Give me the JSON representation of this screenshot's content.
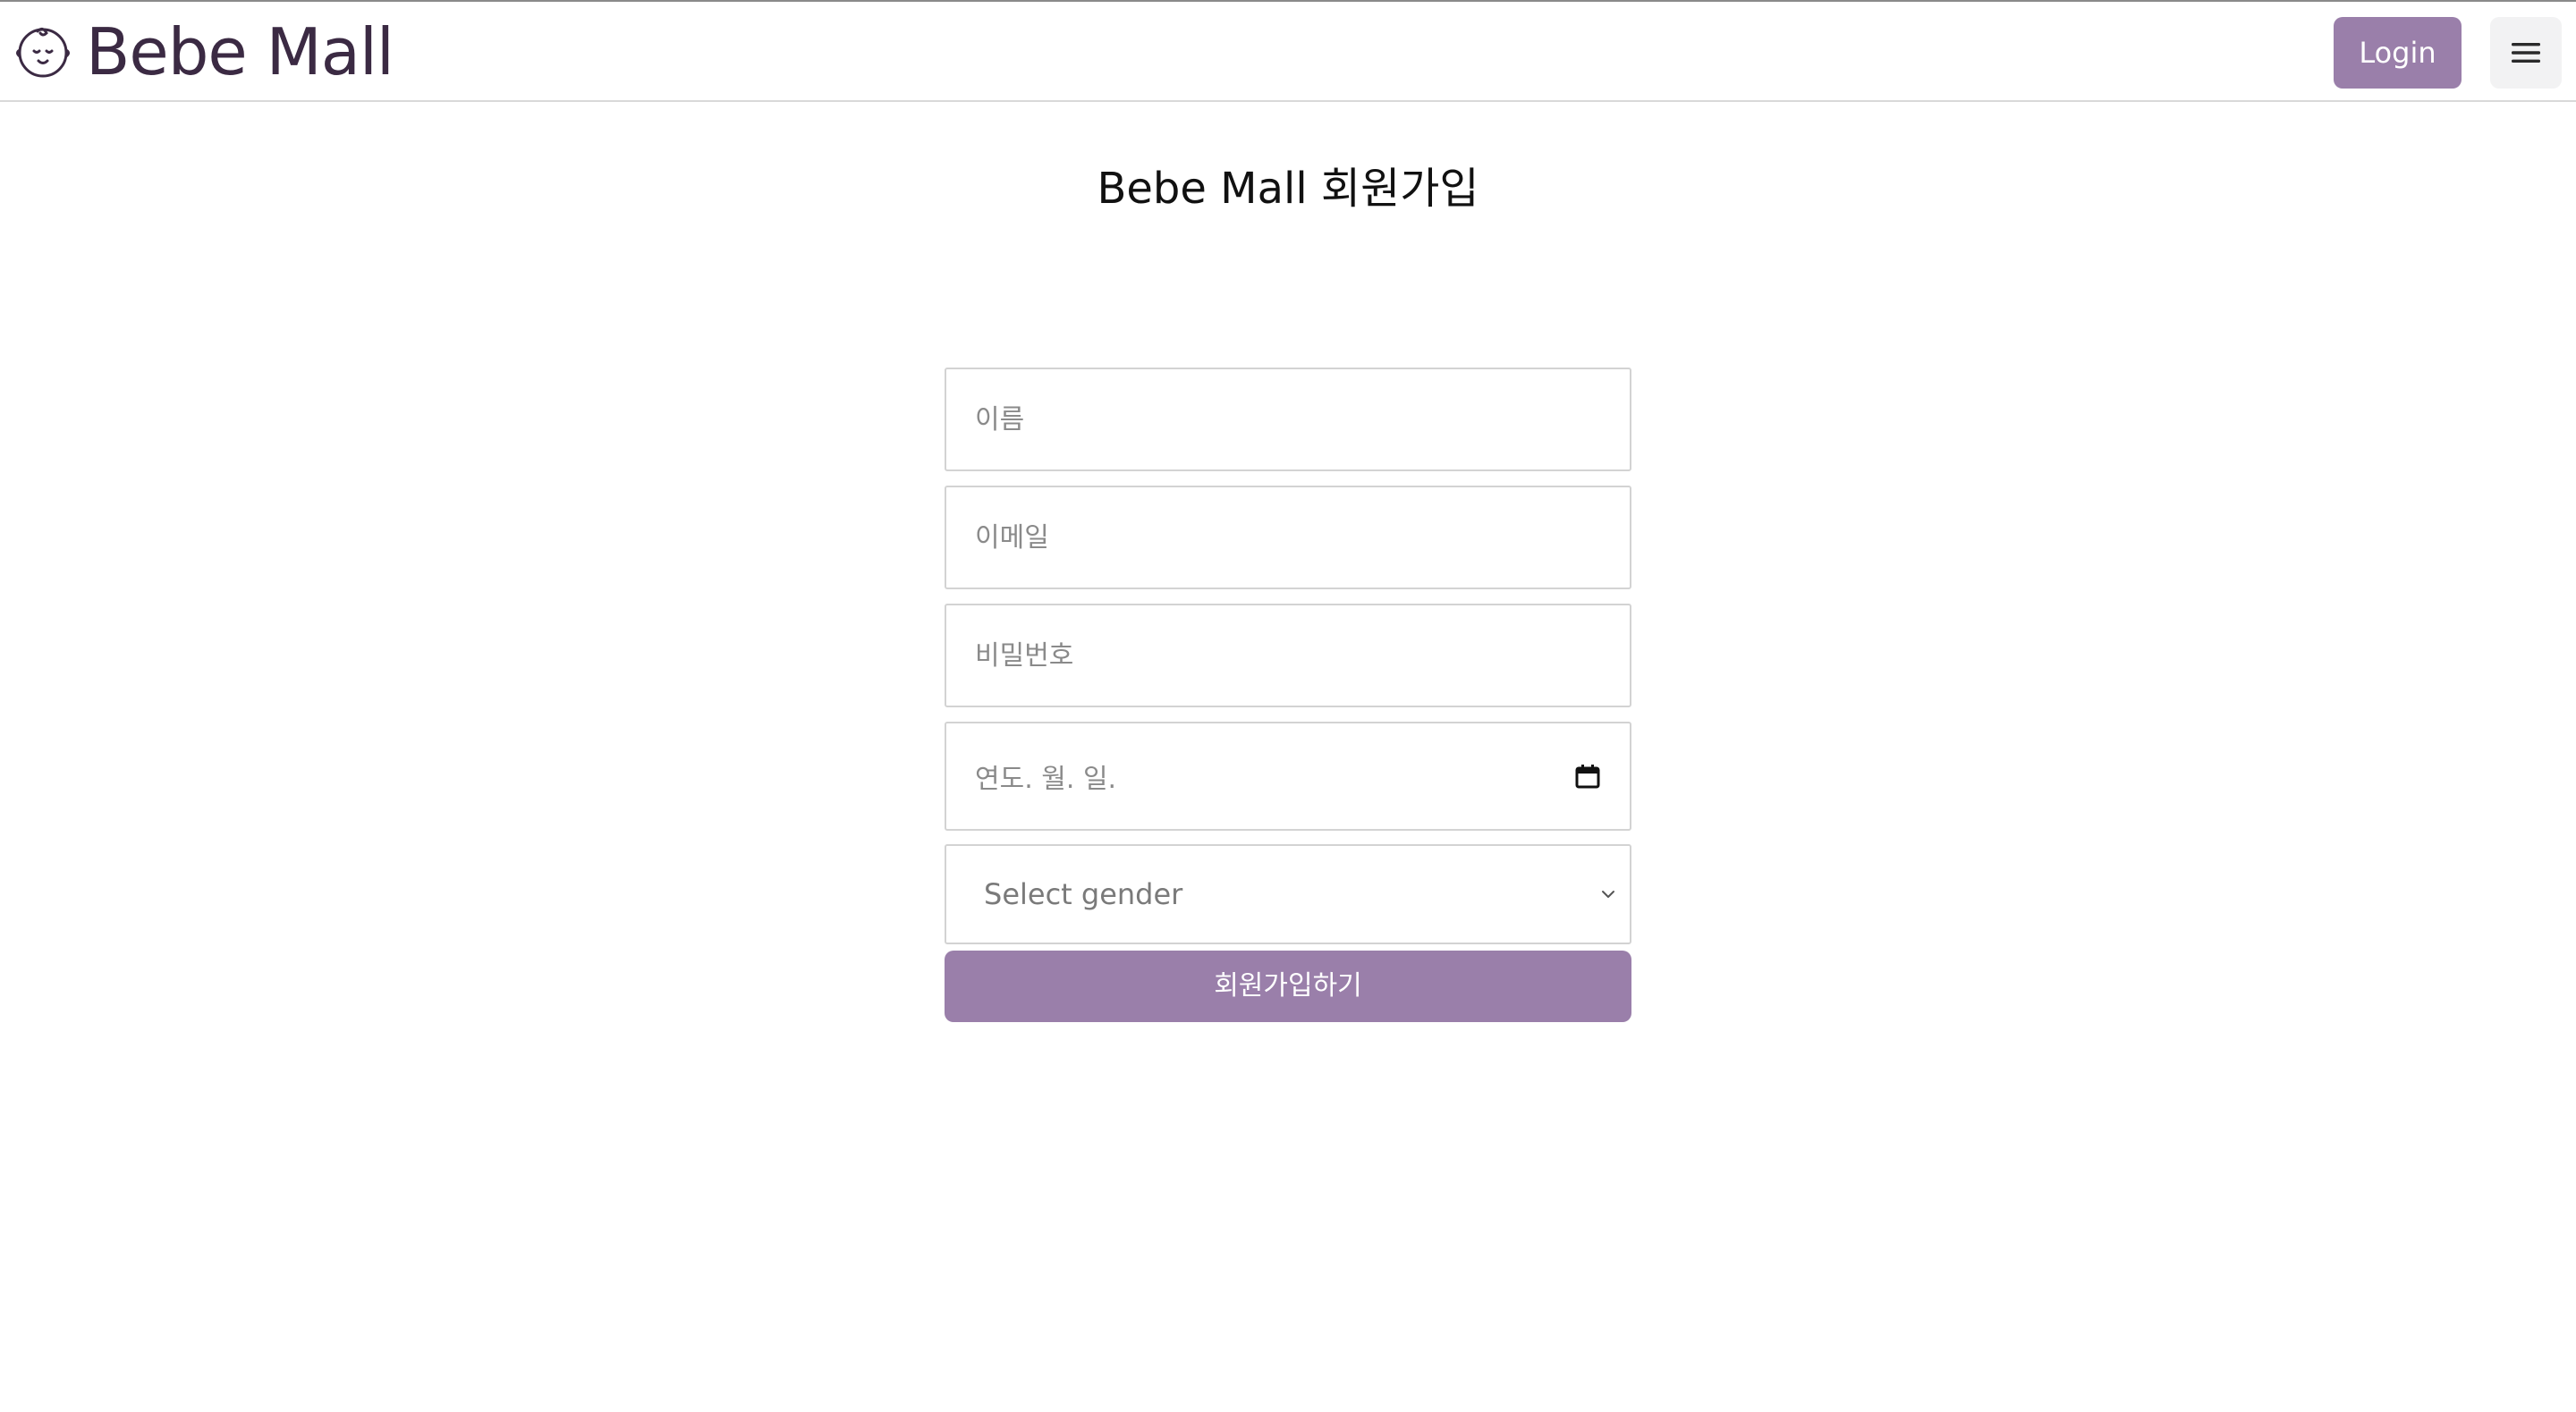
{
  "navbar": {
    "brand_name": "Bebe Mall",
    "brand_icon": "baby-face-icon",
    "login_label": "Login",
    "menu_icon": "hamburger-menu-icon"
  },
  "page": {
    "title": "Bebe Mall 회원가입"
  },
  "form": {
    "name_placeholder": "이름",
    "email_placeholder": "이메일",
    "password_placeholder": "비밀번호",
    "birthdate_placeholder": "연도. 월. 일.",
    "gender_selected": "Select gender",
    "submit_label": "회원가입하기"
  },
  "colors": {
    "accent": "#9a7faa",
    "brand_text": "#3b2a43",
    "border": "#d3d3d3",
    "placeholder": "#8a8a8a"
  }
}
